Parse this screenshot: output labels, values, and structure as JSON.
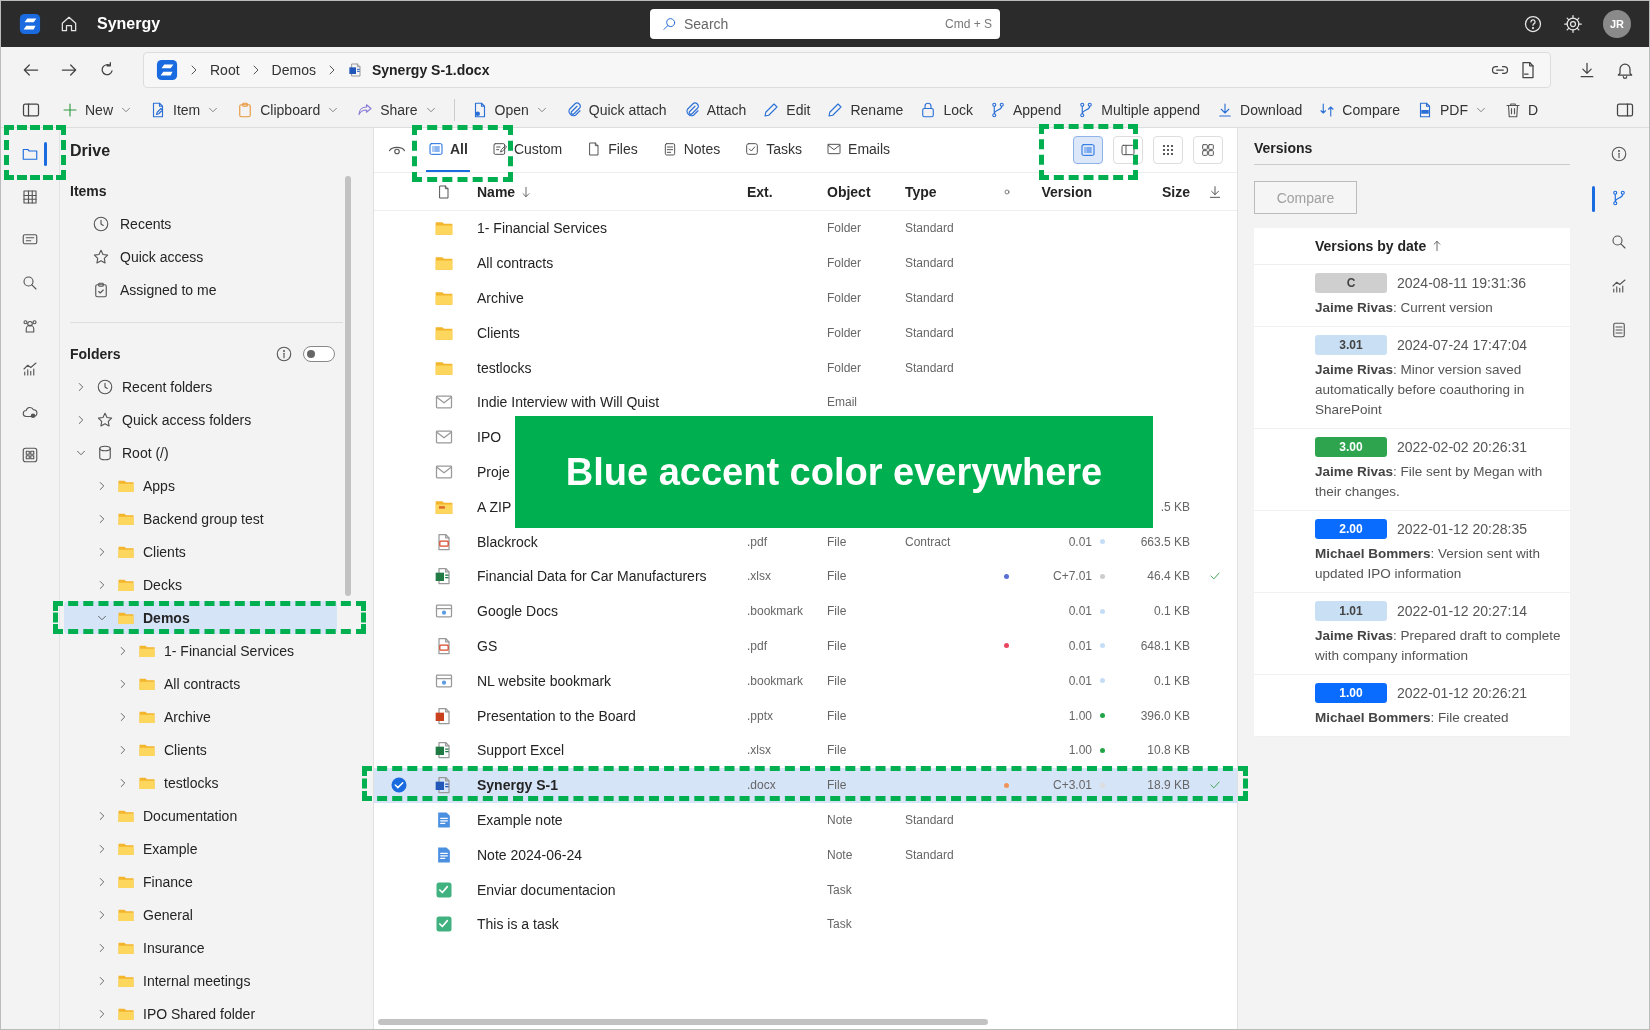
{
  "app": {
    "name": "Synergy",
    "avatar": "JR"
  },
  "search": {
    "placeholder": "Search",
    "shortcut": "Cmd + S"
  },
  "breadcrumb": [
    {
      "label": "Root",
      "kind": "folder"
    },
    {
      "label": "Demos",
      "kind": "folder"
    },
    {
      "label": "Synergy S-1.docx",
      "kind": "file"
    }
  ],
  "toolbar": {
    "groups": [
      [
        {
          "label": "New",
          "dropdown": true
        },
        {
          "label": "Item",
          "dropdown": true
        },
        {
          "label": "Clipboard",
          "dropdown": true
        },
        {
          "label": "Share",
          "dropdown": true
        }
      ],
      [
        {
          "label": "Open",
          "dropdown": true
        },
        {
          "label": "Quick attach",
          "dropdown": false
        },
        {
          "label": "Attach",
          "dropdown": false
        },
        {
          "label": "Edit",
          "dropdown": false
        },
        {
          "label": "Rename",
          "dropdown": false
        },
        {
          "label": "Lock",
          "dropdown": false
        },
        {
          "label": "Append",
          "dropdown": false
        },
        {
          "label": "Multiple append",
          "dropdown": false
        },
        {
          "label": "Download",
          "dropdown": false
        },
        {
          "label": "Compare",
          "dropdown": false
        },
        {
          "label": "PDF",
          "dropdown": true
        },
        {
          "label": "D",
          "dropdown": false
        }
      ]
    ]
  },
  "rail": [
    {
      "selected": true
    },
    {
      "selected": false
    },
    {
      "selected": false
    },
    {
      "selected": false
    },
    {
      "selected": false
    },
    {
      "selected": false
    },
    {
      "selected": false
    },
    {
      "selected": false
    }
  ],
  "sidebar": {
    "title": "Drive",
    "items_heading": "Items",
    "items": [
      {
        "label": "Recents"
      },
      {
        "label": "Quick access"
      },
      {
        "label": "Assigned to me"
      }
    ],
    "folders_heading": "Folders",
    "folders_toggle": {
      "on": false
    },
    "tree": [
      {
        "label": "Recent folders",
        "kind": "recent",
        "expanded": false,
        "selected": false
      },
      {
        "label": "Quick access folders",
        "kind": "favorites",
        "expanded": false,
        "selected": false
      },
      {
        "label": "Root (/)",
        "kind": "drive",
        "expanded": true,
        "selected": false,
        "children": [
          {
            "label": "Apps",
            "kind": "folder",
            "expanded": false,
            "selected": false
          },
          {
            "label": "Backend group test",
            "kind": "folder",
            "expanded": false,
            "selected": false
          },
          {
            "label": "Clients",
            "kind": "folder",
            "expanded": false,
            "selected": false
          },
          {
            "label": "Decks",
            "kind": "folder",
            "expanded": false,
            "selected": false
          },
          {
            "label": "Demos",
            "kind": "folder",
            "expanded": true,
            "selected": true,
            "children": [
              {
                "label": "1- Financial Services",
                "kind": "folder",
                "expanded": false,
                "selected": false
              },
              {
                "label": "All contracts",
                "kind": "folder",
                "expanded": false,
                "selected": false
              },
              {
                "label": "Archive",
                "kind": "folder",
                "expanded": false,
                "selected": false
              },
              {
                "label": "Clients",
                "kind": "folder",
                "expanded": false,
                "selected": false
              },
              {
                "label": "testlocks",
                "kind": "folder",
                "expanded": false,
                "selected": false
              }
            ]
          },
          {
            "label": "Documentation",
            "kind": "folder",
            "expanded": false,
            "selected": false
          },
          {
            "label": "Example",
            "kind": "folder",
            "expanded": false,
            "selected": false
          },
          {
            "label": "Finance",
            "kind": "folder",
            "expanded": false,
            "selected": false
          },
          {
            "label": "General",
            "kind": "folder",
            "expanded": false,
            "selected": false
          },
          {
            "label": "Insurance",
            "kind": "folder",
            "expanded": false,
            "selected": false
          },
          {
            "label": "Internal meetings",
            "kind": "folder",
            "expanded": false,
            "selected": false
          },
          {
            "label": "IPO Shared folder",
            "kind": "folder",
            "expanded": false,
            "selected": false
          }
        ]
      }
    ]
  },
  "tabs": [
    {
      "label": "All",
      "selected": true
    },
    {
      "label": "Custom",
      "selected": false
    },
    {
      "label": "Files",
      "selected": false
    },
    {
      "label": "Notes",
      "selected": false
    },
    {
      "label": "Tasks",
      "selected": false
    },
    {
      "label": "Emails",
      "selected": false
    }
  ],
  "view_buttons": [
    {
      "selected": true
    },
    {
      "selected": false
    },
    {
      "selected": false
    },
    {
      "selected": false
    }
  ],
  "table": {
    "columns": [
      "Name",
      "Ext.",
      "Object",
      "Type",
      "Version",
      "Size"
    ],
    "rows": [
      {
        "name": "1- Financial Services",
        "kind": "folder",
        "object": "Folder",
        "type": "Standard",
        "selected": false,
        "synced": false
      },
      {
        "name": "All contracts",
        "kind": "folder",
        "object": "Folder",
        "type": "Standard",
        "selected": false,
        "synced": false
      },
      {
        "name": "Archive",
        "kind": "folder",
        "object": "Folder",
        "type": "Standard",
        "selected": false,
        "synced": false
      },
      {
        "name": "Clients",
        "kind": "folder",
        "object": "Folder",
        "type": "Standard",
        "selected": false,
        "synced": false
      },
      {
        "name": "testlocks",
        "kind": "folder",
        "object": "Folder",
        "type": "Standard",
        "selected": false,
        "synced": false
      },
      {
        "name": "Indie Interview with Will Quist",
        "kind": "email",
        "object": "Email",
        "selected": false,
        "synced": false
      },
      {
        "name": "IPO",
        "kind": "email",
        "selected": false,
        "synced": false
      },
      {
        "name": "Proje",
        "kind": "email",
        "selected": false,
        "synced": false
      },
      {
        "name": "A ZIP",
        "kind": "zip",
        "size": ".5 KB",
        "selected": false,
        "synced": false
      },
      {
        "name": "Blackrock",
        "kind": "pdf",
        "ext": ".pdf",
        "object": "File",
        "type": "Contract",
        "version": "0.01",
        "version_dot": {
          "color": "#c5def5"
        },
        "size": "663.5 KB",
        "selected": false,
        "synced": false
      },
      {
        "name": "Financial Data for Car Manufacturers",
        "kind": "spreadsheet",
        "ext": ".xlsx",
        "object": "File",
        "status_dot": {
          "color": "#5a6fd6"
        },
        "version": "C+7.01",
        "version_dot": {
          "color": "#cccccc"
        },
        "size": "46.4 KB",
        "selected": false,
        "synced": true
      },
      {
        "name": "Google Docs",
        "kind": "bookmark",
        "ext": ".bookmark",
        "object": "File",
        "version": "0.01",
        "version_dot": {
          "color": "#c5def5"
        },
        "size": "0.1 KB",
        "selected": false,
        "synced": false
      },
      {
        "name": "GS",
        "kind": "pdf",
        "ext": ".pdf",
        "object": "File",
        "status_dot": {
          "color": "#e8475f"
        },
        "version": "0.01",
        "version_dot": {
          "color": "#c5def5"
        },
        "size": "648.1 KB",
        "selected": false,
        "synced": false
      },
      {
        "name": "NL website bookmark",
        "kind": "bookmark",
        "ext": ".bookmark",
        "object": "File",
        "version": "0.01",
        "version_dot": {
          "color": "#c5def5"
        },
        "size": "0.1 KB",
        "selected": false,
        "synced": false
      },
      {
        "name": "Presentation to the Board",
        "kind": "presentation",
        "ext": ".pptx",
        "object": "File",
        "version": "1.00",
        "version_dot": {
          "color": "#22a447"
        },
        "size": "396.0 KB",
        "selected": false,
        "synced": false
      },
      {
        "name": "Support Excel",
        "kind": "spreadsheet",
        "ext": ".xlsx",
        "object": "File",
        "version": "1.00",
        "version_dot": {
          "color": "#22a447"
        },
        "size": "10.8 KB",
        "selected": false,
        "synced": false
      },
      {
        "name": "Synergy S-1",
        "kind": "document",
        "ext": ".docx",
        "object": "File",
        "status_dot": {
          "color": "#f0945a"
        },
        "version": "C+3.01",
        "version_dot": {
          "color": "#dddddd"
        },
        "size": "18.9 KB",
        "selected": true,
        "synced": true
      },
      {
        "name": "Example note",
        "kind": "note",
        "object": "Note",
        "type": "Standard",
        "selected": false,
        "synced": false
      },
      {
        "name": "Note 2024-06-24",
        "kind": "note",
        "object": "Note",
        "type": "Standard",
        "selected": false,
        "synced": false
      },
      {
        "name": "Enviar documentacion",
        "kind": "task",
        "object": "Task",
        "selected": false,
        "synced": false
      },
      {
        "name": "This is a task",
        "kind": "task",
        "object": "Task",
        "selected": false,
        "synced": false
      }
    ]
  },
  "versions": {
    "title": "Versions",
    "compare": {
      "label": "Compare",
      "disabled": true
    },
    "heading": "Versions by date",
    "items": [
      {
        "badge": "C",
        "color": "#cfcfcf",
        "date": "2024-08-11 19:31:36",
        "text": "**Jaime Rivas**:  Current version"
      },
      {
        "badge": "3.01",
        "color": "#c8dff4",
        "date": "2024-07-24 17:47:04",
        "text": "**Jaime Rivas**:  Minor version saved automatically before coauthoring in SharePoint"
      },
      {
        "badge": "3.00",
        "color": "#2ea44f",
        "date": "2022-02-02 20:26:31",
        "text": "**Jaime Rivas**:  File sent by Megan with their changes."
      },
      {
        "badge": "2.00",
        "color": "#0a6cff",
        "date": "2022-01-12 20:28:35",
        "text": "**Michael Bommers**:  Version sent with updated IPO information"
      },
      {
        "badge": "1.01",
        "color": "#c8dff4",
        "date": "2022-01-12 20:27:14",
        "text": "**Jaime Rivas**:  Prepared draft to complete with company information"
      },
      {
        "badge": "1.00",
        "color": "#0a6cff",
        "date": "2022-01-12 20:26:21",
        "text": "**Michael Bommers**:  File created"
      }
    ]
  },
  "right_rail": [
    {
      "selected": false
    },
    {
      "selected": true
    },
    {
      "selected": false
    },
    {
      "selected": false
    },
    {
      "selected": false
    }
  ],
  "callout": {
    "text": "Blue accent color everywhere"
  }
}
